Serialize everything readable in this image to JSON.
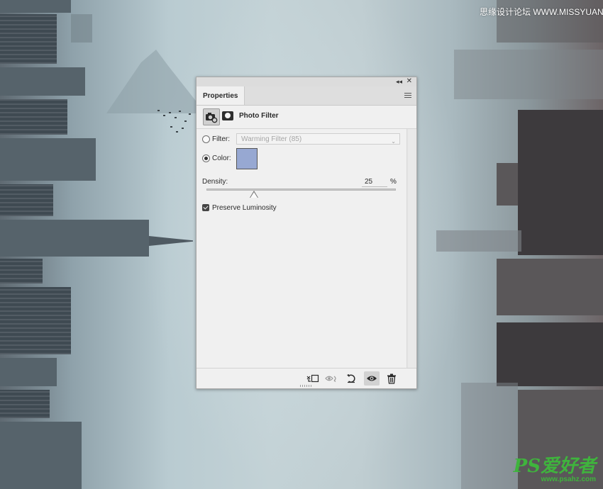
{
  "panel": {
    "tab_label": "Properties",
    "adjustment_title": "Photo Filter",
    "filter_label": "Filter:",
    "filter_value": "Warming Filter (85)",
    "filter_selected": false,
    "color_label": "Color:",
    "color_selected": true,
    "color_value": "#97a8d2",
    "density_label": "Density:",
    "density_value": "25",
    "density_unit": "%",
    "density_fraction": 0.25,
    "preserve_luminosity_label": "Preserve Luminosity",
    "preserve_luminosity_checked": true
  },
  "footer_buttons": [
    {
      "name": "clip-to-layer",
      "icon": "clip-layer-icon"
    },
    {
      "name": "view-previous-state",
      "icon": "eye-previous-icon"
    },
    {
      "name": "reset-adjustment",
      "icon": "reset-icon"
    },
    {
      "name": "toggle-visibility",
      "icon": "eye-icon"
    },
    {
      "name": "delete-adjustment",
      "icon": "trash-icon"
    }
  ],
  "watermark": {
    "top_text": "思缘设计论坛 WWW.MISSYUAN.COM",
    "logo_text": "PS爱好者",
    "logo_url": "www.psahz.com"
  }
}
